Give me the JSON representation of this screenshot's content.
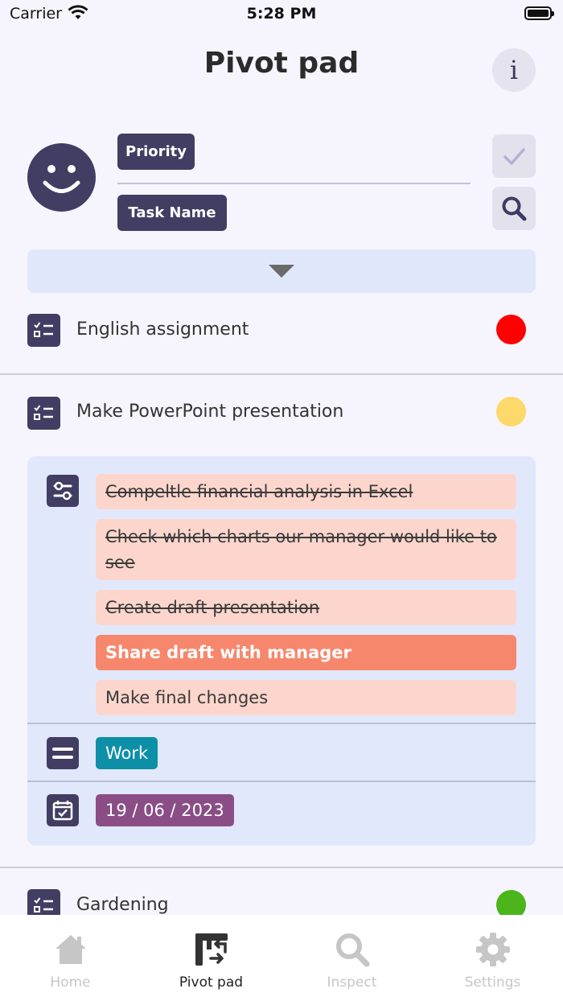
{
  "status": {
    "carrier": "Carrier",
    "time": "5:28 PM"
  },
  "header": {
    "title": "Pivot pad",
    "info_label": "i"
  },
  "form": {
    "priority_label": "Priority",
    "task_name_label": "Task Name"
  },
  "tasks": [
    {
      "title": "English assignment",
      "priority_color": "#ff0000"
    },
    {
      "title": "Make PowerPoint presentation",
      "priority_color": "#fdd86a"
    },
    {
      "title": "Gardening",
      "priority_color": "#4cb51c"
    }
  ],
  "expanded": {
    "subtasks": [
      {
        "text": "Compeltle financial analysis in Excel",
        "state": "done"
      },
      {
        "text": "Check which charts our manager would like to see",
        "state": "done"
      },
      {
        "text": "Create draft presentation",
        "state": "done"
      },
      {
        "text": "Share draft with manager",
        "state": "active"
      },
      {
        "text": "Make final changes",
        "state": "todo"
      }
    ],
    "category": {
      "label": "Work",
      "color": "#0e8fa8"
    },
    "date": {
      "label": "19 / 06 / 2023",
      "color": "#8a4d86"
    }
  },
  "tabs": [
    {
      "label": "Home",
      "icon": "home-icon",
      "active": false
    },
    {
      "label": "Pivot pad",
      "icon": "pivot-pad-icon",
      "active": true
    },
    {
      "label": "Inspect",
      "icon": "magnifier-icon",
      "active": false
    },
    {
      "label": "Settings",
      "icon": "gear-icon",
      "active": false
    }
  ]
}
